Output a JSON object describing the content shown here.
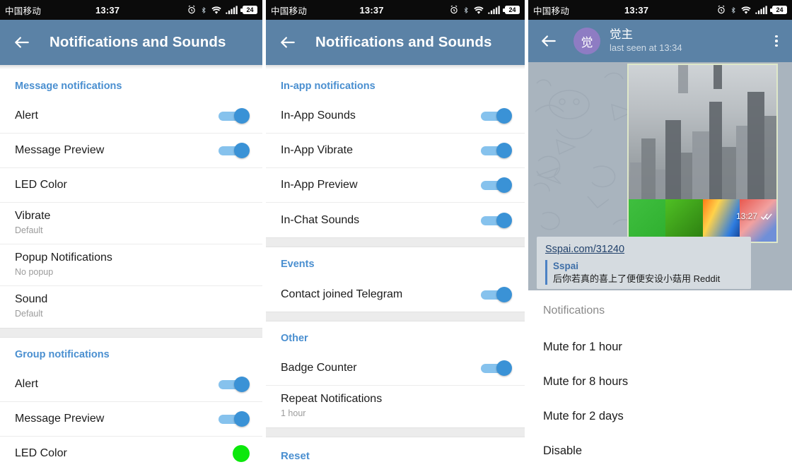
{
  "status_bar": {
    "carrier": "中国移动",
    "time": "13:37",
    "battery_level": "24",
    "icons": [
      "alarm-icon",
      "bluetooth-icon",
      "wifi-icon",
      "signal-icon",
      "battery-icon"
    ]
  },
  "panel1": {
    "title": "Notifications and Sounds",
    "back_label": "back-arrow",
    "sections": [
      {
        "header": "Message notifications",
        "rows": [
          {
            "title": "Alert",
            "sub": "",
            "control": "toggle",
            "on": true
          },
          {
            "title": "Message Preview",
            "sub": "",
            "control": "toggle",
            "on": true
          },
          {
            "title": "LED Color",
            "sub": "",
            "control": "none"
          },
          {
            "title": "Vibrate",
            "sub": "Default",
            "control": "none"
          },
          {
            "title": "Popup Notifications",
            "sub": "No popup",
            "control": "none"
          },
          {
            "title": "Sound",
            "sub": "Default",
            "control": "none"
          }
        ]
      },
      {
        "header": "Group notifications",
        "rows": [
          {
            "title": "Alert",
            "sub": "",
            "control": "toggle",
            "on": true
          },
          {
            "title": "Message Preview",
            "sub": "",
            "control": "toggle",
            "on": true
          },
          {
            "title": "LED Color",
            "sub": "",
            "control": "color",
            "color": "#0ce80c"
          }
        ]
      }
    ]
  },
  "panel2": {
    "title": "Notifications and Sounds",
    "sections": [
      {
        "header": "In-app notifications",
        "rows": [
          {
            "title": "In-App Sounds",
            "sub": "",
            "control": "toggle",
            "on": true
          },
          {
            "title": "In-App Vibrate",
            "sub": "",
            "control": "toggle",
            "on": true
          },
          {
            "title": "In-App Preview",
            "sub": "",
            "control": "toggle",
            "on": true
          },
          {
            "title": "In-Chat Sounds",
            "sub": "",
            "control": "toggle",
            "on": true
          }
        ]
      },
      {
        "header": "Events",
        "rows": [
          {
            "title": "Contact joined Telegram",
            "sub": "",
            "control": "toggle",
            "on": true
          }
        ]
      },
      {
        "header": "Other",
        "rows": [
          {
            "title": "Badge Counter",
            "sub": "",
            "control": "toggle",
            "on": true
          },
          {
            "title": "Repeat Notifications",
            "sub": "1 hour",
            "control": "none"
          }
        ]
      }
    ],
    "reset_label": "Reset"
  },
  "panel3": {
    "contact_name": "觉主",
    "contact_status": "last seen at 13:34",
    "avatar_initial": "觉",
    "avatar_color": "#8e7cc3",
    "message": {
      "time": "13:27",
      "read_state": "double-check",
      "thumbnails": [
        "green-grass",
        "green-leaves",
        "rainbow-colors",
        "red-star"
      ]
    },
    "link_preview": {
      "url": "Sspai.com/31240",
      "site": "Sspai",
      "description": "后你若真的喜上了便便安设小菇用 Reddit"
    },
    "menu": {
      "title": "Notifications",
      "items": [
        "Mute for 1 hour",
        "Mute for 8 hours",
        "Mute for 2 days",
        "Disable"
      ]
    }
  },
  "theme": {
    "appbar": "#5b82a6",
    "accent": "#4a8fd0",
    "toggle_on": "#3a92d6",
    "toggle_track": "#86c2ed",
    "statusbar": "#0b0b0b"
  }
}
